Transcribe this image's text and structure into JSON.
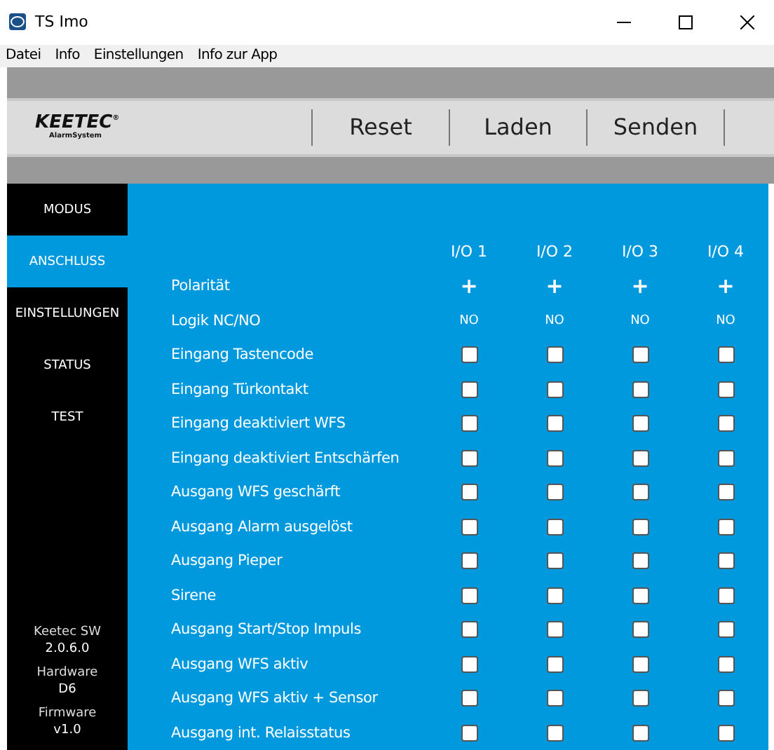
{
  "window": {
    "title": "TS Imo"
  },
  "menu": [
    "Datei",
    "Info",
    "Einstellungen",
    "Info zur App"
  ],
  "toolbar": {
    "logo": "KEETEC",
    "logo_mark": "®",
    "logo_sub": "AlarmSystem",
    "buttons": [
      "Reset",
      "Laden",
      "Senden"
    ]
  },
  "sidebar": {
    "items": [
      {
        "label": "MODUS",
        "selected": false
      },
      {
        "label": "ANSCHLUSS",
        "selected": true
      },
      {
        "label": "EINSTELLUNGEN",
        "selected": false
      },
      {
        "label": "STATUS",
        "selected": false
      },
      {
        "label": "TEST",
        "selected": false
      }
    ],
    "info": [
      {
        "label": "Keetec SW",
        "value": "2.0.6.0"
      },
      {
        "label": "Hardware",
        "value": "D6"
      },
      {
        "label": "Firmware",
        "value": "v1.0"
      }
    ]
  },
  "table": {
    "columns": [
      "I/O 1",
      "I/O 2",
      "I/O 3",
      "I/O 4"
    ],
    "rows": [
      {
        "label": "Polarität",
        "kind": "sign",
        "cells": [
          "+",
          "+",
          "+",
          "+"
        ]
      },
      {
        "label": "Logik NC/NO",
        "kind": "text",
        "cells": [
          "NO",
          "NO",
          "NO",
          "NO"
        ]
      },
      {
        "label": "Eingang Tastencode",
        "kind": "checkbox",
        "cells": [
          false,
          false,
          false,
          false
        ]
      },
      {
        "label": "Eingang Türkontakt",
        "kind": "checkbox",
        "cells": [
          false,
          false,
          false,
          false
        ]
      },
      {
        "label": "Eingang deaktiviert WFS",
        "kind": "checkbox",
        "cells": [
          false,
          false,
          false,
          false
        ]
      },
      {
        "label": "Eingang deaktiviert Entschärfen",
        "kind": "checkbox",
        "cells": [
          false,
          false,
          false,
          false
        ]
      },
      {
        "label": "Ausgang WFS geschärft",
        "kind": "checkbox",
        "cells": [
          false,
          false,
          false,
          false
        ]
      },
      {
        "label": "Ausgang Alarm ausgelöst",
        "kind": "checkbox",
        "cells": [
          false,
          false,
          false,
          false
        ]
      },
      {
        "label": "Ausgang Pieper",
        "kind": "checkbox",
        "cells": [
          false,
          false,
          false,
          false
        ]
      },
      {
        "label": "Sirene",
        "kind": "checkbox",
        "cells": [
          false,
          false,
          false,
          false
        ]
      },
      {
        "label": "Ausgang Start/Stop Impuls",
        "kind": "checkbox",
        "cells": [
          false,
          false,
          false,
          false
        ]
      },
      {
        "label": "Ausgang WFS aktiv",
        "kind": "checkbox",
        "cells": [
          false,
          false,
          false,
          false
        ]
      },
      {
        "label": "Ausgang WFS aktiv + Sensor",
        "kind": "checkbox",
        "cells": [
          false,
          false,
          false,
          false
        ]
      },
      {
        "label": "Ausgang int. Relaisstatus",
        "kind": "checkbox",
        "cells": [
          false,
          false,
          false,
          false
        ]
      }
    ]
  }
}
